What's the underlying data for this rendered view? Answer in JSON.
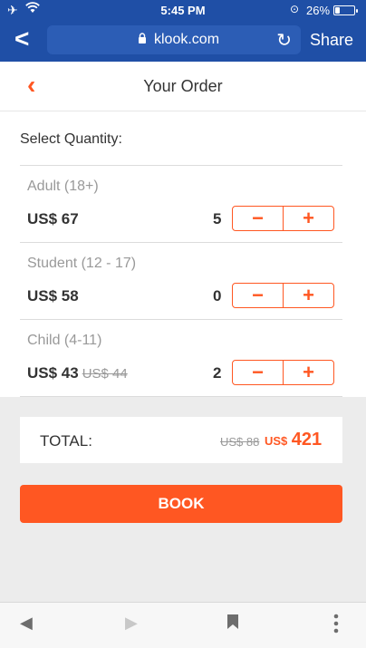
{
  "status": {
    "time": "5:45 PM",
    "battery_pct": "26%",
    "battery_level": 0.26
  },
  "browser": {
    "url": "klook.com",
    "share_label": "Share"
  },
  "header": {
    "title": "Your Order"
  },
  "select_label": "Select Quantity:",
  "items": [
    {
      "label": "Adult (18+)",
      "price": "US$ 67",
      "old_price": "",
      "qty": "5"
    },
    {
      "label": "Student (12 - 17)",
      "price": "US$ 58",
      "old_price": "",
      "qty": "0"
    },
    {
      "label": "Child (4-11)",
      "price": "US$ 43",
      "old_price": "US$ 44",
      "qty": "2"
    }
  ],
  "total": {
    "label": "TOTAL:",
    "old": "US$ 88",
    "currency": "US$",
    "amount": "421"
  },
  "book_label": "BOOK",
  "colors": {
    "brand": "#ff5722",
    "chrome": "#1f4fa6"
  }
}
